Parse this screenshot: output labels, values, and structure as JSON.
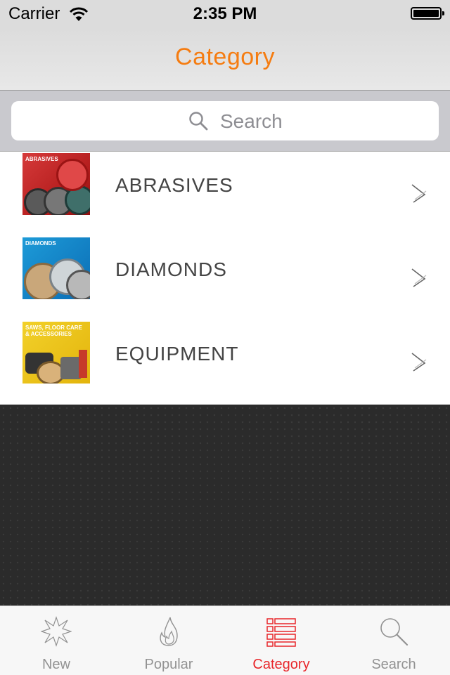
{
  "status_bar": {
    "carrier": "Carrier",
    "time": "2:35 PM"
  },
  "nav": {
    "title": "Category"
  },
  "search": {
    "placeholder": "Search"
  },
  "categories": [
    {
      "label": "ABRASIVES",
      "thumb_text": "ABRASIVES"
    },
    {
      "label": "DIAMONDS",
      "thumb_text": "DIAMONDS"
    },
    {
      "label": "EQUIPMENT",
      "thumb_text": "SAWS, FLOOR CARE & ACCESSORIES"
    }
  ],
  "tabbar": {
    "tabs": [
      {
        "label": "New",
        "icon": "starburst-icon"
      },
      {
        "label": "Popular",
        "icon": "flame-icon"
      },
      {
        "label": "Category",
        "icon": "list-icon",
        "active": true
      },
      {
        "label": "Search",
        "icon": "search-icon"
      }
    ]
  },
  "colors": {
    "title_orange": "#f57c11",
    "tab_active_red": "#e8262a",
    "tab_inactive_gray": "#929292"
  }
}
